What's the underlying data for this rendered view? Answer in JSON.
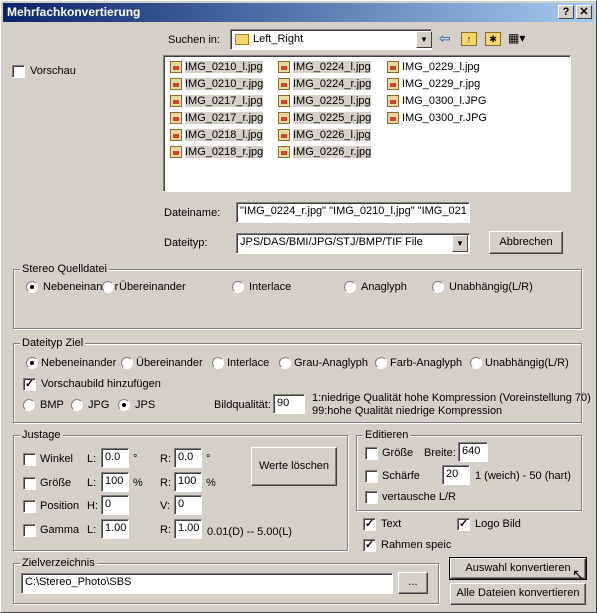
{
  "window": {
    "title": "Mehrfachkonvertierung",
    "help_label": "?",
    "close_label": "✕"
  },
  "preview": {
    "label": "Vorschau",
    "checked": false
  },
  "lookin": {
    "label": "Suchen in:",
    "value": "Left_Right"
  },
  "files": {
    "col1": [
      "IMG_0210_l.jpg",
      "IMG_0210_r.jpg",
      "IMG_0217_l.jpg",
      "IMG_0217_r.jpg",
      "IMG_0218_l.jpg",
      "IMG_0218_r.jpg"
    ],
    "col2": [
      "IMG_0224_l.jpg",
      "IMG_0224_r.jpg",
      "IMG_0225_l.jpg",
      "IMG_0225_r.jpg",
      "IMG_0226_l.jpg",
      "IMG_0226_r.jpg"
    ],
    "col3": [
      "IMG_0229_l.jpg",
      "IMG_0229_r.jpg",
      "IMG_0300_l.JPG",
      "IMG_0300_r.JPG"
    ]
  },
  "filename": {
    "label": "Dateiname:",
    "value": "\"IMG_0224_r.jpg\" \"IMG_0210_l.jpg\" \"IMG_021"
  },
  "filetype": {
    "label": "Dateityp:",
    "value": "JPS/DAS/BMI/JPG/STJ/BMP/TIF File"
  },
  "cancel_label": "Abbrechen",
  "source": {
    "legend": "Stereo Quelldatei",
    "options": [
      "Nebeneinander",
      "Übereinander",
      "Interlace",
      "Anaglyph",
      "Unabhängig(L/R)"
    ],
    "selected": "Nebeneinander"
  },
  "target": {
    "legend": "Dateityp Ziel",
    "options": [
      "Nebeneinander",
      "Übereinander",
      "Interlace",
      "Grau-Anaglyph",
      "Farb-Anaglyph",
      "Unabhängig(L/R)"
    ],
    "selected": "Nebeneinander",
    "thumb_label": "Vorschaubild hinzufügen",
    "formats": [
      "BMP",
      "JPG",
      "JPS"
    ],
    "format_selected": "JPS",
    "quality_label": "Bildqualität:",
    "quality_value": "90",
    "quality_hint1": "1:niedrige Qualität hohe Kompression (Voreinstellung 70)",
    "quality_hint2": "99:hohe Qualität niedrige Kompression"
  },
  "justage": {
    "legend": "Justage",
    "rows": [
      {
        "name": "Winkel",
        "l_label": "L:",
        "l_value": "0.0",
        "l_unit": "°",
        "r_label": "R:",
        "r_value": "0.0",
        "r_unit": "°"
      },
      {
        "name": "Größe",
        "l_label": "L:",
        "l_value": "100",
        "l_unit": "%",
        "r_label": "R:",
        "r_value": "100",
        "r_unit": "%"
      },
      {
        "name": "Position",
        "l_label": "H:",
        "l_value": "0",
        "l_unit": "",
        "r_label": "V:",
        "r_value": "0",
        "r_unit": ""
      },
      {
        "name": "Gamma",
        "l_label": "L:",
        "l_value": "1.00",
        "l_unit": "",
        "r_label": "R:",
        "r_value": "1.00",
        "r_unit": ""
      }
    ],
    "gamma_hint": "0.01(D) -- 5.00(L)",
    "reset_label": "Werte löschen"
  },
  "edit": {
    "legend": "Editieren",
    "size_label": "Größe",
    "width_label": "Breite:",
    "width_value": "640",
    "sharp_label": "Schärfe",
    "sharp_value": "20",
    "sharp_hint": "1 (weich) - 50 (hart)",
    "swap_label": "vertausche L/R"
  },
  "opts": {
    "text_label": "Text",
    "logo_label": "Logo Bild",
    "frame_label": "Rahmen speic"
  },
  "target_dir": {
    "legend": "Zielverzeichnis",
    "value": "C:\\Stereo_Photo\\SBS",
    "browse_label": "..."
  },
  "convert_selected_label": "Auswahl konvertieren",
  "convert_all_label": "Alle Dateien konvertieren"
}
